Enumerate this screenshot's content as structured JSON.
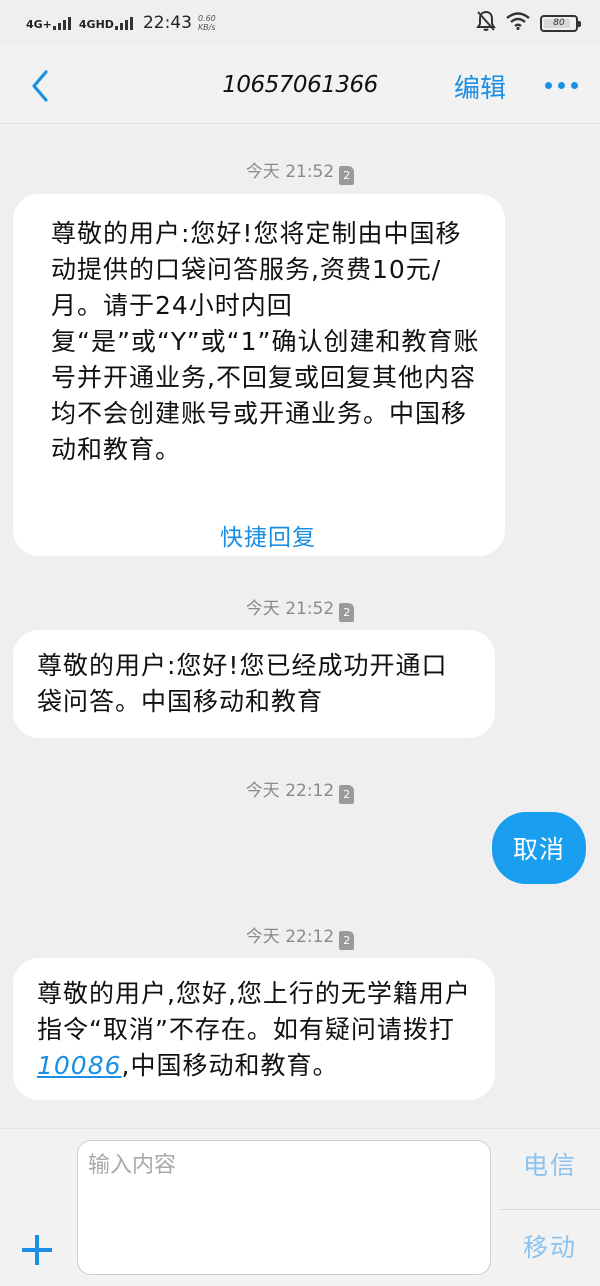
{
  "status_bar": {
    "network1": "4G+",
    "network2": "4GHD",
    "time": "22:43",
    "speed_value": "0.60",
    "speed_unit": "KB/s",
    "battery": "80"
  },
  "header": {
    "title": "10657061366",
    "edit_label": "编辑"
  },
  "messages": [
    {
      "timestamp": "今天 21:52",
      "sim": "2",
      "text": "尊敬的用户:您好!您将定制由中国移动提供的口袋问答服务,资费10元/月。请于24小时内回复“是”或“Y”或“1”确认创建和教育账号并开通业务,不回复或回复其他内容均不会创建账号或开通业务。中国移动和教育。",
      "quick_reply": "快捷回复"
    },
    {
      "timestamp": "今天 21:52",
      "sim": "2",
      "text": "尊敬的用户:您好!您已经成功开通口袋问答。中国移动和教育"
    },
    {
      "timestamp": "今天 22:12",
      "sim": "2",
      "text": "取消"
    },
    {
      "timestamp": "今天 22:12",
      "sim": "2",
      "text_before": "尊敬的用户,您好,您上行的无学籍用户指令“取消”不存在。如有疑问请拨打",
      "link": "10086",
      "text_after": ",中国移动和教育。"
    }
  ],
  "input": {
    "placeholder": "输入内容",
    "send_sim1": "电信",
    "send_sim2": "移动"
  },
  "colors": {
    "accent": "#1a8fe3",
    "sent_bubble": "#1a9ff0",
    "background": "#efefef"
  },
  "icons": [
    "back-arrow-icon",
    "more-icon",
    "plus-icon",
    "sim-card-icon",
    "mute-bell-icon",
    "wifi-icon",
    "battery-icon"
  ]
}
